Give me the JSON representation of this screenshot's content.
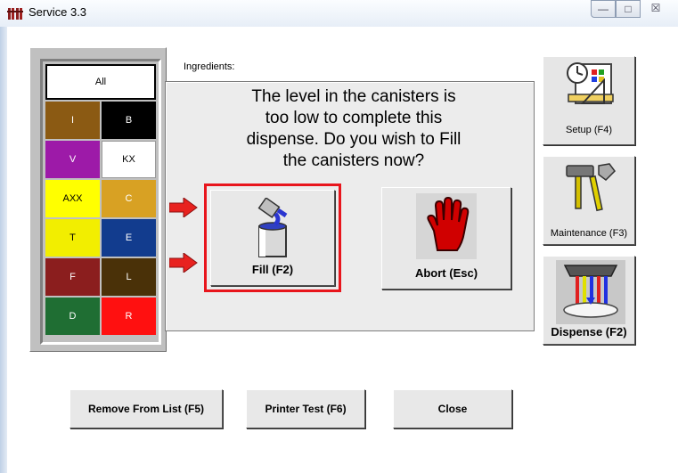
{
  "window": {
    "title": "Service 3.3",
    "min_symbol": "—",
    "max_symbol": "□",
    "close_symbol": "☒"
  },
  "palette": {
    "all_label": "All",
    "cells": [
      {
        "label": "I",
        "color": "#8b5a13",
        "text_color": "#ffffff"
      },
      {
        "label": "B",
        "color": "#000000",
        "text_color": "#ffffff"
      },
      {
        "label": "V",
        "color": "#9d1aa8",
        "text_color": "#ffffff"
      },
      {
        "label": "KX",
        "color": "#ffffff",
        "text_color": "#000000"
      },
      {
        "label": "AXX",
        "color": "#ffff00",
        "text_color": "#000000"
      },
      {
        "label": "C",
        "color": "#d8a123",
        "text_color": "#ffffff"
      },
      {
        "label": "T",
        "color": "#f2ee00",
        "text_color": "#000000"
      },
      {
        "label": "E",
        "color": "#123c8e",
        "text_color": "#ffffff"
      },
      {
        "label": "F",
        "color": "#8b1e1e",
        "text_color": "#ffffff"
      },
      {
        "label": "L",
        "color": "#4a3108",
        "text_color": "#ffffff"
      },
      {
        "label": "D",
        "color": "#1f6e33",
        "text_color": "#ffffff"
      },
      {
        "label": "R",
        "color": "#ff1010",
        "text_color": "#ffffff"
      }
    ]
  },
  "ingredients_label": "Ingredients:",
  "dialog": {
    "message_lines": [
      "The level in the canisters is",
      "too low to complete this",
      "dispense. Do you wish to Fill",
      "the canisters now?"
    ],
    "fill_label": "Fill (F2)",
    "abort_label": "Abort (Esc)"
  },
  "side_buttons": {
    "setup": "Setup (F4)",
    "maintenance": "Maintenance (F3)",
    "dispense": "Dispense (F2)"
  },
  "bottom_buttons": {
    "remove": "Remove From List (F5)",
    "printer_test": "Printer Test (F6)",
    "close": "Close"
  },
  "colors": {
    "highlight": "#e8151c",
    "arrow": "#e8221f"
  }
}
